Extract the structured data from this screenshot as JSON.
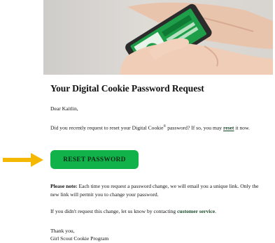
{
  "email": {
    "title": "Your Digital Cookie Password Request",
    "greeting": "Dear Kaitlin,",
    "request_text_1": "Did you recently request to reset your Digital Cookie",
    "registered_mark": "®",
    "request_text_2": " password? If so, you may ",
    "reset_link": "reset",
    "request_text_3": " it now.",
    "reset_button": "RESET PASSWORD",
    "note_label": "Please note:",
    "note_text": " Each time you request a password change, we will email you a unique link. Only the new link will permit you to change your password.",
    "nochange_text": "If you didn't request this change, let us know by contacting ",
    "service_link": "customer service",
    "nochange_end": ".",
    "thanks": "Thank you,",
    "signature": "Girl Scout Cookie Program"
  },
  "colors": {
    "button": "#12b24a",
    "arrow": "#f5b800",
    "link": "#1a4a2a"
  },
  "icons": {
    "hero": "hand-holding-phone-photo",
    "arrow": "arrow-right-icon"
  }
}
